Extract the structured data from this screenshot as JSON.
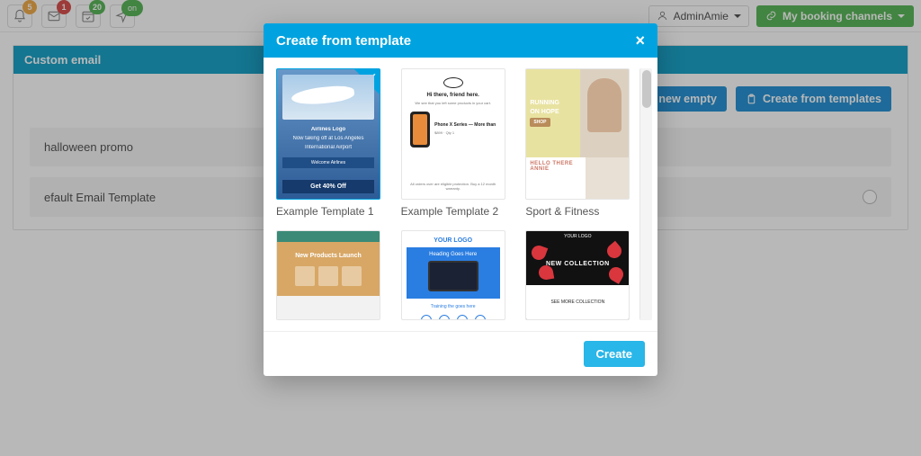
{
  "topbar": {
    "badges": {
      "bell": "5",
      "mail": "1",
      "cal": "20",
      "send": "on"
    },
    "user_label": "AdminAmie",
    "booking_label": "My booking channels"
  },
  "panel": {
    "title": "Custom email",
    "create_empty": "Create new empty",
    "create_templates": "Create from templates",
    "rows": [
      {
        "name": "halloween promo"
      },
      {
        "name": "efault Email Template"
      }
    ]
  },
  "modal": {
    "title": "Create from template",
    "create": "Create",
    "templates": [
      {
        "label": "Example Template 1",
        "selected": true,
        "t1": {
          "brand": "Airlines Logo",
          "sub1": "Now taking off at Los Angeles",
          "sub2": "International Airport",
          "welcome": "Welcome Airlines",
          "off": "Get 40% Off"
        }
      },
      {
        "label": "Example Template 2",
        "selected": false,
        "t2": {
          "greet": "Hi there, friend here."
        }
      },
      {
        "label": "Sport & Fitness",
        "selected": false,
        "t3": {
          "l1": "RUNNING",
          "l2": "ON HOPE",
          "btn": "SHOP",
          "hello": "HELLO THERE ANNIE"
        }
      },
      {
        "label": "",
        "selected": false,
        "t4": {
          "title": "New Products Launch"
        }
      },
      {
        "label": "",
        "selected": false,
        "t5": {
          "logo": "YOUR LOGO",
          "head": "Heading Goes Here",
          "tag": "Training the goes here"
        }
      },
      {
        "label": "",
        "selected": false,
        "t6": {
          "logo": "YOUR LOGO",
          "title": "NEW COLLECTION",
          "foot": "SEE MORE COLLECTION"
        }
      }
    ]
  }
}
